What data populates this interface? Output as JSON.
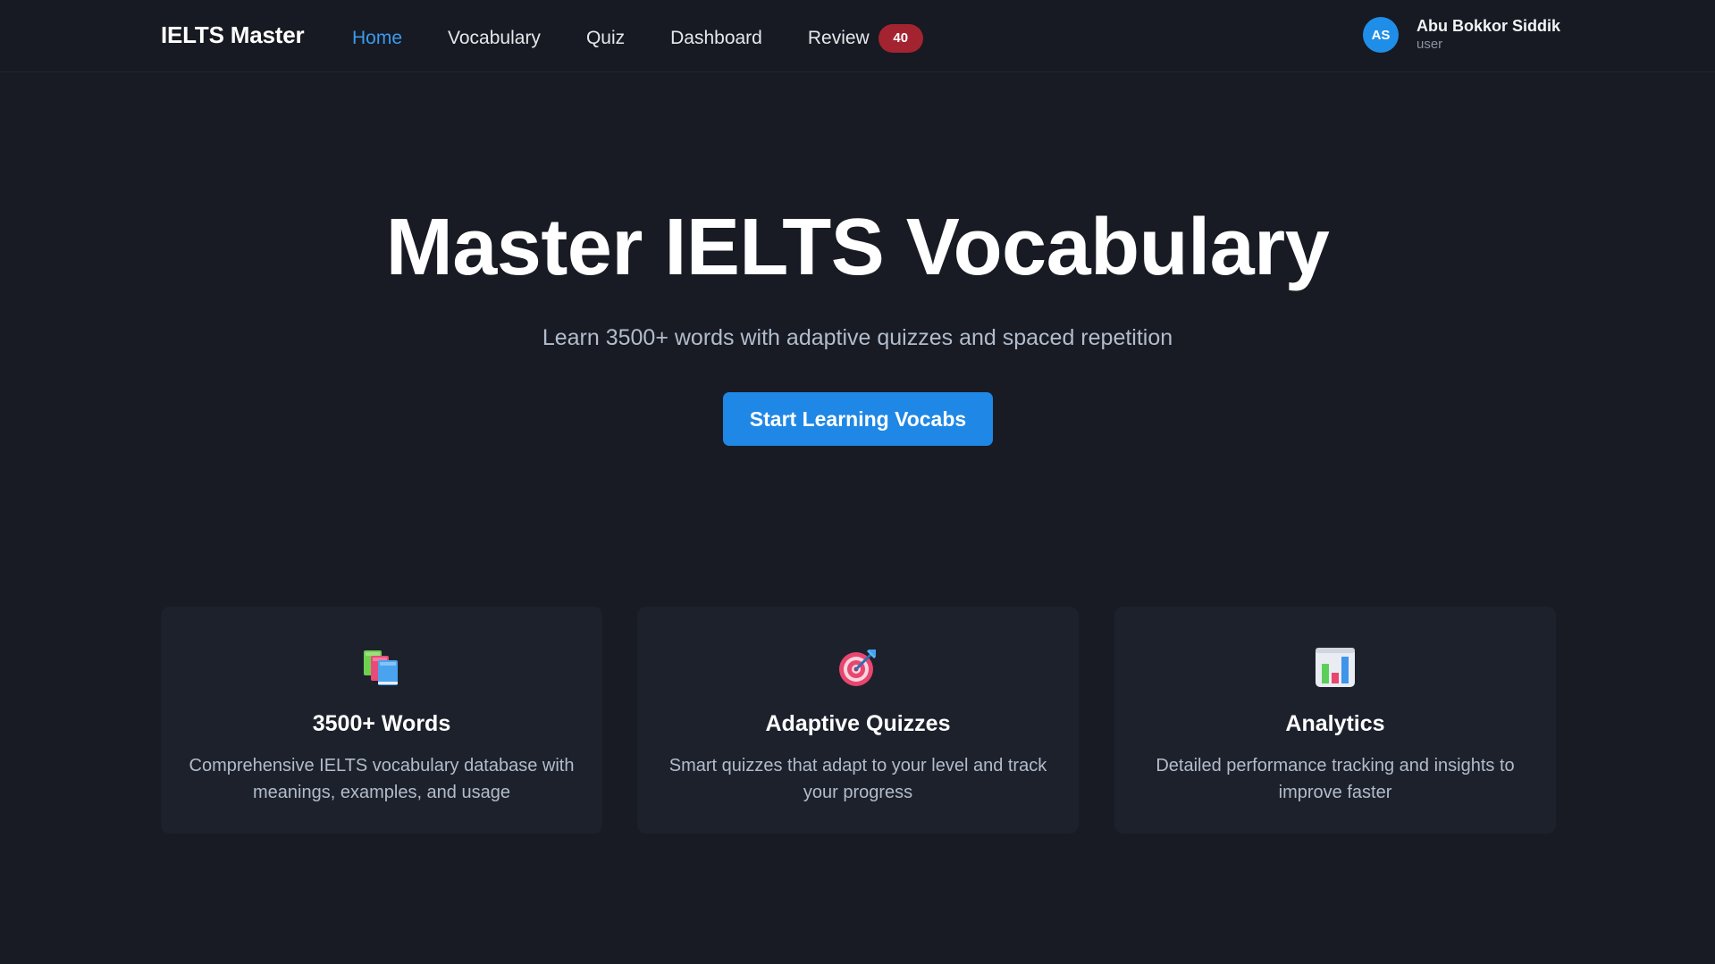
{
  "nav": {
    "brand": "IELTS Master",
    "links": [
      {
        "label": "Home"
      },
      {
        "label": "Vocabulary"
      },
      {
        "label": "Quiz"
      },
      {
        "label": "Dashboard"
      },
      {
        "label": "Review"
      }
    ],
    "review_badge": "40",
    "active": "Home"
  },
  "user": {
    "initials": "AS",
    "name": "Abu Bokkor Siddik",
    "role": "user"
  },
  "hero": {
    "title": "Master IELTS Vocabulary",
    "subtitle": "Learn 3500+ words with adaptive quizzes and spaced repetition",
    "cta_label": "Start Learning Vocabs"
  },
  "features": [
    {
      "icon": "books-icon",
      "title": "3500+ Words",
      "description": "Comprehensive IELTS vocabulary database with meanings, examples, and usage"
    },
    {
      "icon": "target-icon",
      "title": "Adaptive Quizzes",
      "description": "Smart quizzes that adapt to your level and track your progress"
    },
    {
      "icon": "bar-chart-icon",
      "title": "Analytics",
      "description": "Detailed performance tracking and insights to improve faster"
    }
  ],
  "colors": {
    "background": "#181b24",
    "navbar": "#171a22",
    "card": "#1d212c",
    "accent": "#1f87e5",
    "active_link": "#3b9af0",
    "badge": "#a32430",
    "muted_text": "#b2bccb"
  }
}
